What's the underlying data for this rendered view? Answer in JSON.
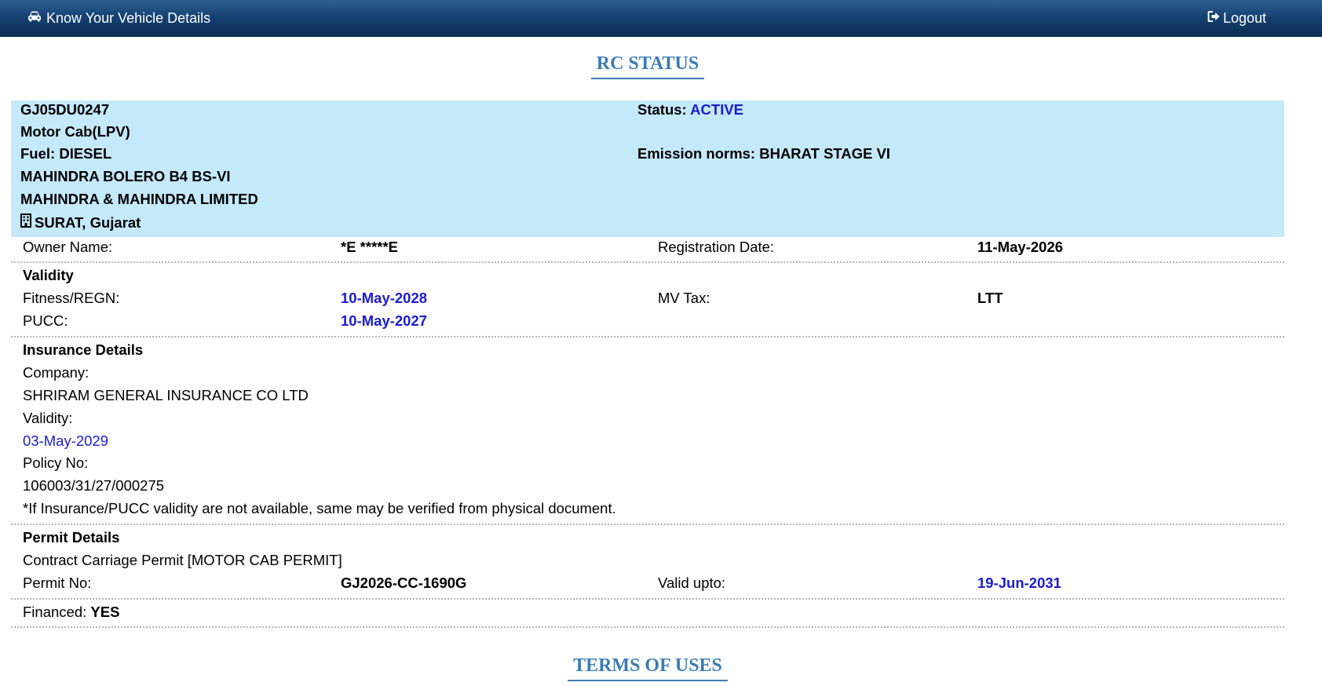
{
  "navbar": {
    "title": "Know Your Vehicle Details",
    "title_icon": "car-icon",
    "logout_label": "Logout",
    "logout_icon": "sign-out-icon"
  },
  "rc_heading": "RC STATUS",
  "vehicle": {
    "reg_no": "GJ05DU0247",
    "vehicle_class": "Motor Cab(LPV)",
    "fuel": "Fuel: DIESEL",
    "model": "MAHINDRA BOLERO B4 BS-VI",
    "maker": "MAHINDRA & MAHINDRA LIMITED",
    "rto": "SURAT, Gujarat",
    "rto_icon": "building-icon",
    "status_label": "Status:",
    "status_value": "ACTIVE",
    "emission": "Emission norms: BHARAT STAGE VI"
  },
  "owner": {
    "owner_label": "Owner Name:",
    "owner_value": "*E *****E",
    "reg_date_label": "Registration Date:",
    "reg_date_value": "11-May-2026"
  },
  "validity": {
    "heading": "Validity",
    "fitness_label": "Fitness/REGN:",
    "fitness_value": "10-May-2028",
    "tax_label": "MV Tax:",
    "tax_value": "LTT",
    "pucc_label": "PUCC:",
    "pucc_value": "10-May-2027"
  },
  "insurance": {
    "heading": "Insurance Details",
    "company_label": "Company:",
    "company_value": "SHRIRAM GENERAL INSURANCE CO LTD",
    "validity_label": "Validity:",
    "validity_value": "03-May-2029",
    "policy_label": "Policy No:",
    "policy_value": "106003/31/27/000275",
    "note": "*If Insurance/PUCC validity are not available, same may be verified from physical document."
  },
  "permit": {
    "heading": "Permit Details",
    "type": "Contract Carriage Permit [MOTOR CAB PERMIT]",
    "no_label": "Permit No:",
    "no_value": "GJ2026-CC-1690G",
    "valid_label": "Valid upto:",
    "valid_value": "19-Jun-2031"
  },
  "finance": {
    "label": "Financed:",
    "value": "YES"
  },
  "terms_heading": "TERMS OF USES",
  "colors": {
    "navbar": "#154273",
    "heading": "#3b7cb4",
    "vehicle_box": "#c4e9fb",
    "date_blue": "#1b1bd0"
  }
}
